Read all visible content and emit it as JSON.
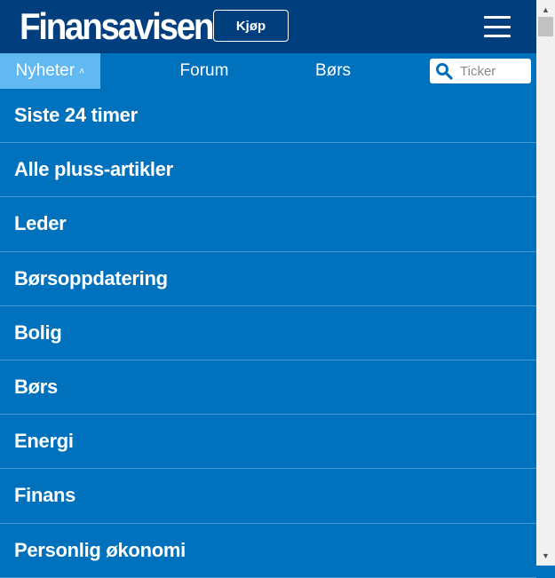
{
  "header": {
    "logo_text": "Finansavisen",
    "buy_label": "Kjøp",
    "menu_icon": "hamburger-menu-icon"
  },
  "nav": {
    "active_label": "Nyheter",
    "active_chevron": "˄",
    "forum_label": "Forum",
    "bors_label": "Børs",
    "search_placeholder": "Ticker",
    "search_icon": "search-icon"
  },
  "menu": {
    "items": [
      "Siste 24 timer",
      "Alle pluss-artikler",
      "Leder",
      "Børsoppdatering",
      "Bolig",
      "Børs",
      "Energi",
      "Finans",
      "Personlig økonomi"
    ]
  },
  "colors": {
    "header_bg": "#003e7e",
    "nav_bg": "#0071bc",
    "active_tab_bg": "#62b8f0",
    "text": "#ffffff"
  }
}
